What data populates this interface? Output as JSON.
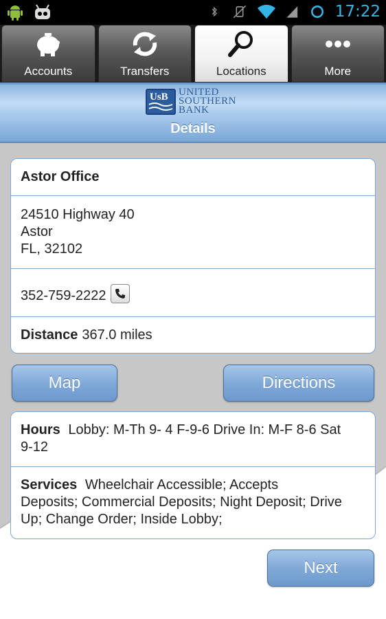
{
  "status_bar": {
    "time": "17:22",
    "icons": [
      "android-icon",
      "cyanogen-icon",
      "bluetooth-icon",
      "vibrate-off-icon",
      "wifi-icon",
      "signal-icon",
      "sync-icon"
    ]
  },
  "tabs": [
    {
      "label": "Accounts",
      "icon": "piggy-bank-icon"
    },
    {
      "label": "Transfers",
      "icon": "transfer-arrows-icon"
    },
    {
      "label": "Locations",
      "icon": "magnifier-icon",
      "active": true
    },
    {
      "label": "More",
      "icon": "more-dots-icon"
    }
  ],
  "logo": {
    "mark": "UsB",
    "line1": "UNITED",
    "line2": "SOUTHERN",
    "line3": "BANK"
  },
  "header": {
    "title": "Details"
  },
  "location": {
    "name": "Astor Office",
    "address_line1": "24510 Highway 40",
    "address_line2": "Astor",
    "address_line3": "FL, 32102",
    "phone": "352-759-2222",
    "distance_label": "Distance",
    "distance_value": "367.0 miles"
  },
  "buttons": {
    "map": "Map",
    "directions": "Directions",
    "next": "Next"
  },
  "info": {
    "hours_label": "Hours",
    "hours_line1": "Lobby: M-Th 9- 4 F-9-6 Drive In: M-F 8-6 Sat",
    "hours_line2": "9-12",
    "services_label": "Services",
    "services_line1": "Wheelchair Accessible; Accepts",
    "services_line2": "Deposits; Commercial Deposits; Night Deposit; Drive",
    "services_line3": "Up; Change Order; Inside Lobby;"
  },
  "colors": {
    "accent": "#33b5e5",
    "brand_blue": "#2d5c9e",
    "border_blue": "#7fa6d3"
  }
}
